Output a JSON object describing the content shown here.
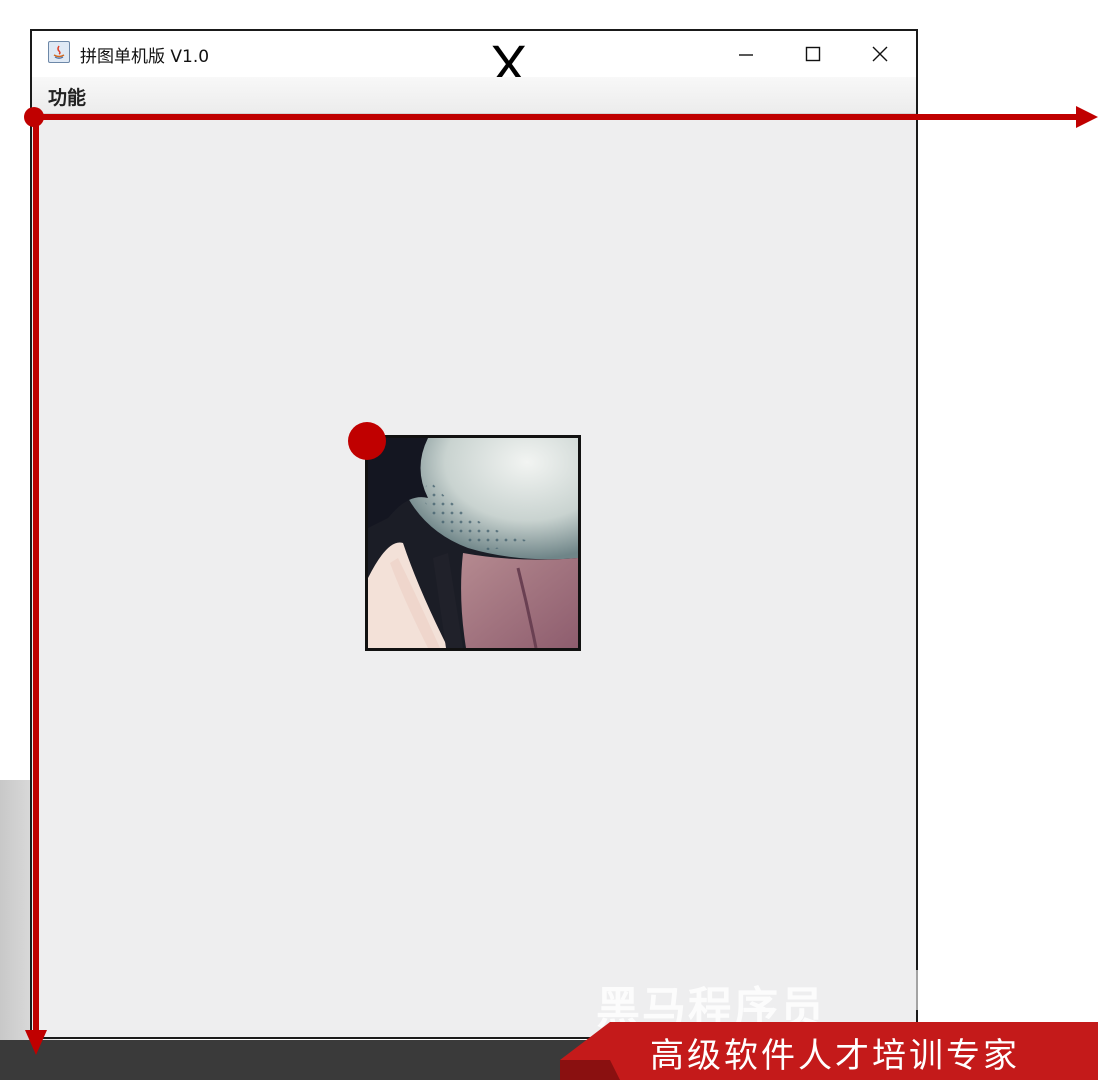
{
  "window": {
    "title": "拼图单机版 V1.0",
    "annotation_mark": "X",
    "controls": [
      "minimize",
      "maximize",
      "close"
    ]
  },
  "menu": {
    "items": [
      {
        "label": "功能"
      }
    ]
  },
  "annotation": {
    "axis_color": "#c00000",
    "x_axis_direction": "right",
    "y_axis_direction": "down",
    "origin_markers": [
      "window-content-origin",
      "tile-origin"
    ]
  },
  "watermarks": {
    "brand": "黑马程序员",
    "slogan": "高级软件人才培训专家",
    "banner_color": "#c41a1a"
  }
}
